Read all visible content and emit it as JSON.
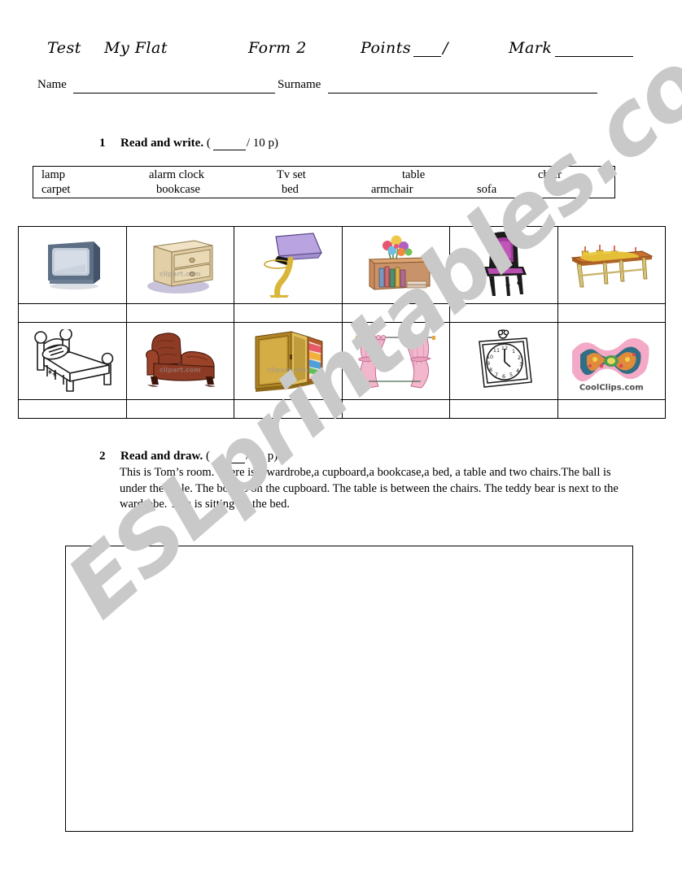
{
  "header": {
    "test_label": "Test",
    "topic": "My Flat",
    "form": "Form 2",
    "points_label": "Points",
    "points_slash": "/",
    "mark_label": "Mark",
    "name_label": "Name",
    "surname_label": "Surname"
  },
  "exercise1": {
    "number": "1",
    "title": "Read and write.",
    "points_open": "(",
    "points_value": "/ 10 p)",
    "wordbank_row1": [
      "lamp",
      "alarm clock",
      "Tv set",
      "table",
      "chair"
    ],
    "wordbank_row2": [
      "carpet",
      "bookcase",
      "bed",
      "armchair",
      "sofa"
    ],
    "pictures_row1": [
      "tv-set",
      "chest-of-drawers",
      "lamp",
      "bookcase",
      "chair",
      "table"
    ],
    "pictures_row2": [
      "bed",
      "armchair",
      "wardrobe",
      "curtains",
      "alarm-clock",
      "carpet"
    ],
    "answers_row1": [
      "",
      "",
      "",
      "",
      "",
      ""
    ],
    "answers_row2": [
      "",
      "",
      "",
      "",
      "",
      ""
    ],
    "clipart_marks": {
      "chest": "clipart.com",
      "armchair": "clipart.com",
      "wardrobe": "clipart.com",
      "carpet": "CoolClips.com"
    }
  },
  "exercise2": {
    "number": "2",
    "title": "Read and draw.",
    "points_open": "(",
    "points_value": "/ 10 p)",
    "text": "This is Tom’s room. There is a wardrobe,a cupboard,a bookcase,a bed, a table and two chairs.The ball is under the table. The boat is on the cupboard. The table is between the chairs. The teddy bear is next to the wardrobe. Tom is sitting on the bed."
  },
  "watermark": {
    "text": "ESLprintables.com",
    "color": "#c9c9c9"
  },
  "colors": {
    "ink": "#000000",
    "page": "#ffffff",
    "tv_body": "#5d6f85",
    "tv_screen": "#c3ccd9",
    "wood_light": "#e2cfa8",
    "wood_mid": "#c9ad7d",
    "lamp_shade": "#b9a3e0",
    "lamp_stand": "#d9b63a",
    "bookcase": "#c98a5e",
    "chair_purple": "#a3399b",
    "chair_dark": "#1b1b1b",
    "table_top": "#c8702e",
    "table_cloth": "#e8c53a",
    "armchair": "#8e3b25",
    "wardrobe": "#c99a2e",
    "curtain_pink": "#f2b7cc",
    "carpet_pink": "#f4a9c6",
    "carpet_teal": "#2f6e84",
    "carpet_orange": "#e08a3c"
  }
}
